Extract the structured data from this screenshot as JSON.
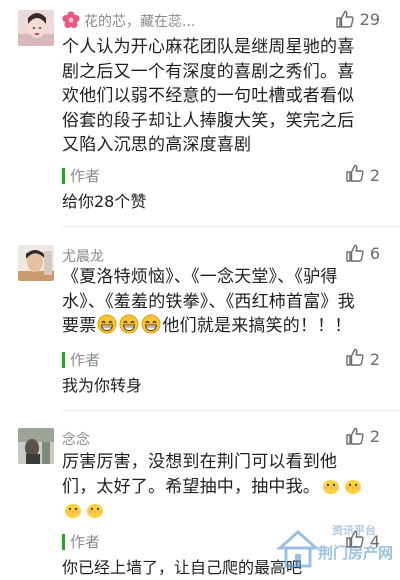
{
  "comments": [
    {
      "user": "花的芯，藏在蕊...",
      "likes": "29",
      "lines": [
        "个人认为开心麻花团队是继周星驰的喜",
        "剧之后又一个有深度的喜剧之秀们。喜",
        "欢他们以弱不经意的一句吐槽或者看似",
        "俗套的段子却让人捧腹大笑，笑完之后",
        "又陷入沉思的高深度喜剧"
      ],
      "reply": {
        "label": "作者",
        "text": "给你28个赞",
        "likes": "2"
      }
    },
    {
      "user": "尤晨龙",
      "likes": "6",
      "lines": [
        "《夏洛特烦恼》、《一念天堂》、《驴得",
        "水》、《羞羞的铁拳》、《西红柿首富》我",
        "要票",
        "他们就是来搞笑的！！！"
      ],
      "reply": {
        "label": "作者",
        "text": "我为你转身",
        "likes": "2"
      }
    },
    {
      "user": "念念",
      "likes": "2",
      "lines": [
        "厉害厉害，没想到在荆门可以看到他",
        "们，太好了。希望抽中，抽中我。"
      ],
      "reply": {
        "label": "作者",
        "text": "你已经上墙了，让自己爬的最高吧",
        "likes": "4"
      }
    }
  ],
  "watermark": {
    "line1": "资讯平台",
    "line2": "荆门房产网"
  },
  "colors": {
    "accent": "#1aad19",
    "name": "#8a8a8a",
    "like": "#6b6b6b"
  },
  "icons": {
    "like": "thumbs-up-icon",
    "emoji_grin": "grinning-face-icon",
    "emoji_chick": "yellow-chick-icon"
  }
}
